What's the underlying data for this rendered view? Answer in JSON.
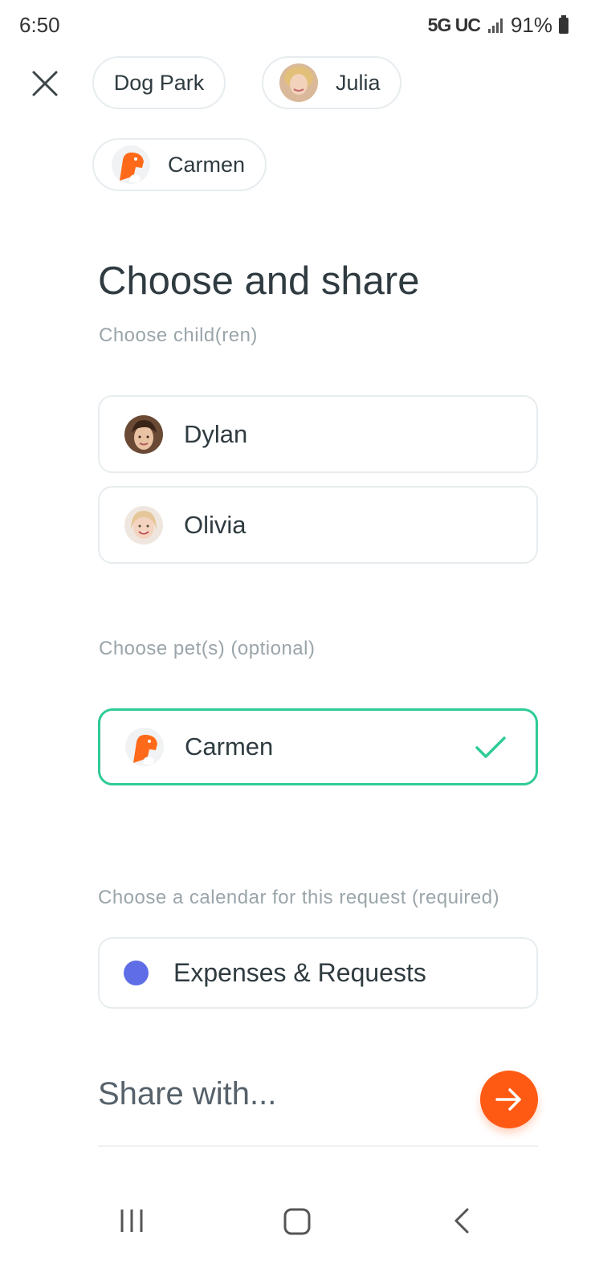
{
  "status_bar": {
    "time": "6:50",
    "network": "5G UC",
    "battery": "91%"
  },
  "chips": {
    "location": "Dog Park",
    "person": "Julia",
    "pet": "Carmen"
  },
  "title": "Choose and share",
  "children_section": {
    "label": "Choose child(ren)",
    "options": [
      {
        "name": "Dylan",
        "selected": false
      },
      {
        "name": "Olivia",
        "selected": false
      }
    ]
  },
  "pets_section": {
    "label": "Choose pet(s) (optional)",
    "options": [
      {
        "name": "Carmen",
        "selected": true
      }
    ]
  },
  "calendar_section": {
    "label": "Choose a calendar for this request (required)",
    "selected": {
      "name": "Expenses & Requests",
      "color": "#5f6ee6"
    }
  },
  "share": {
    "label": "Share with..."
  },
  "colors": {
    "accent_orange": "#ff5a14",
    "selected_green": "#2ecb97"
  },
  "icons": {
    "close": "close-icon",
    "check": "check-icon",
    "next": "arrow-right-icon",
    "nav": [
      "recents-icon",
      "home-icon",
      "back-icon"
    ]
  }
}
